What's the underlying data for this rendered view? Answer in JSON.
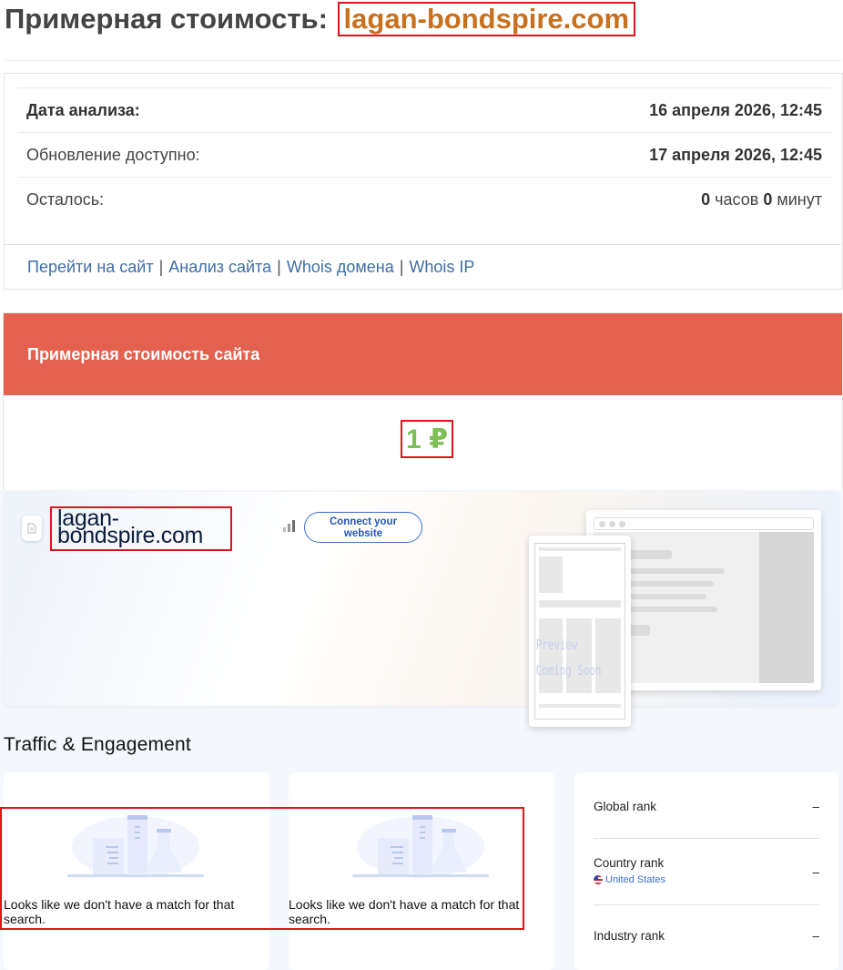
{
  "header": {
    "title_prefix": "Примерная стоимость:",
    "domain": "lagan-bondspire.com"
  },
  "info": {
    "rows": [
      {
        "label": "Дата анализа:",
        "value": "16 апреля 2026, 12:45"
      },
      {
        "label": "Обновление доступно:",
        "value": "17 апреля 2026, 12:45"
      },
      {
        "label": "Осталось:",
        "hours": "0",
        "hours_unit": "часов",
        "minutes": "0",
        "minutes_unit": "минут"
      }
    ],
    "links": [
      "Перейти на сайт",
      "Анализ сайта",
      "Whois домена",
      "Whois IP"
    ],
    "link_separator": "|"
  },
  "estimate": {
    "header": "Примерная стоимость сайта",
    "value": "1 ₽"
  },
  "similarweb": {
    "domain_line1": "lagan-",
    "domain_line2": "bondspire.com",
    "connect_line1": "Connect your",
    "connect_line2": "website",
    "preview_line1": "Preview",
    "preview_line2": "Coming Soon",
    "section_title": "Traffic & Engagement",
    "no_match_message": "Looks like we don't have a match for that search.",
    "ranks": [
      {
        "label": "Global rank",
        "value": "–"
      },
      {
        "label": "Country rank",
        "sub": "United States",
        "value": "–"
      },
      {
        "label": "Industry rank",
        "value": "–"
      }
    ]
  },
  "colors": {
    "domain_accent": "#c8701e",
    "estimate_header_bg": "#e46150",
    "estimate_value": "#7dbf55",
    "link": "#3e6da5",
    "highlight_box": "#e0131b"
  }
}
